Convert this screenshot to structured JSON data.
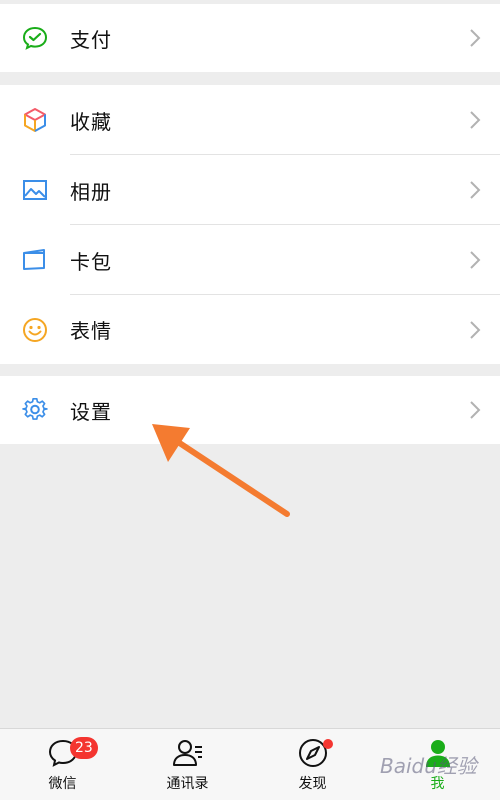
{
  "menu": {
    "pay_label": "支付",
    "favorites_label": "收藏",
    "album_label": "相册",
    "cards_label": "卡包",
    "stickers_label": "表情",
    "settings_label": "设置"
  },
  "tabbar": {
    "chats_label": "微信",
    "chats_badge": "23",
    "contacts_label": "通讯录",
    "discover_label": "发现",
    "me_label": "我"
  },
  "watermark": "Baidu经验",
  "colors": {
    "accent_green": "#1aad19",
    "badge_red": "#f43530",
    "annotation_arrow": "#f47b30",
    "background": "#ededed"
  }
}
